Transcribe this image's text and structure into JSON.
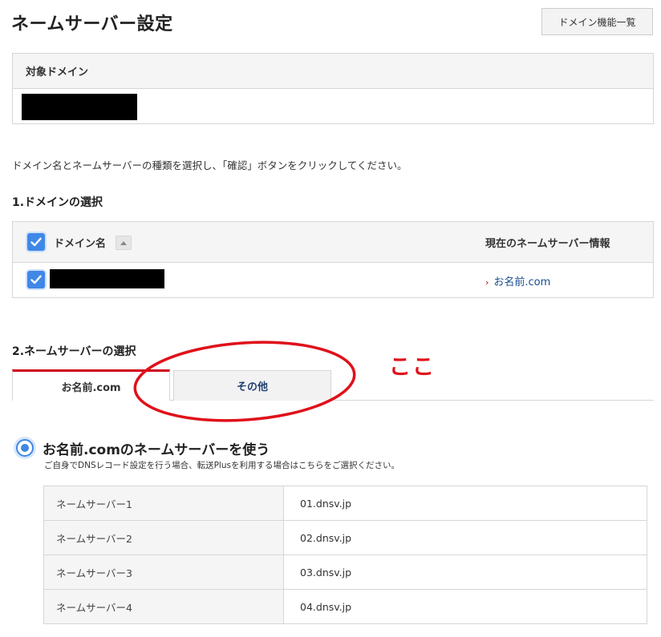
{
  "header": {
    "title": "ネームサーバー設定",
    "domain_list_button": "ドメイン機能一覧"
  },
  "target_domain": {
    "heading": "対象ドメイン"
  },
  "instruction": "ドメイン名とネームサーバーの種類を選択し、「確認」ボタンをクリックしてください。",
  "section1": {
    "title": "1.ドメインの選択",
    "columns": {
      "domain": "ドメイン名",
      "current_ns": "現在のネームサーバー情報"
    },
    "rows": [
      {
        "checked": true,
        "current_ns": "お名前.com"
      }
    ]
  },
  "section2": {
    "title": "2.ネームサーバーの選択",
    "tabs": [
      {
        "label": "お名前.com",
        "active": true
      },
      {
        "label": "その他",
        "active": false
      }
    ],
    "option": {
      "label": "お名前.comのネームサーバーを使う",
      "note": "ご自身でDNSレコード設定を行う場合、転送Plusを利用する場合はこちらをご選択ください。",
      "selected": true
    },
    "nameservers": [
      {
        "label": "ネームサーバー1",
        "value": "01.dnsv.jp"
      },
      {
        "label": "ネームサーバー2",
        "value": "02.dnsv.jp"
      },
      {
        "label": "ネームサーバー3",
        "value": "03.dnsv.jp"
      },
      {
        "label": "ネームサーバー4",
        "value": "04.dnsv.jp"
      }
    ]
  },
  "annotation": {
    "text": "ここ",
    "color": "#e0101a"
  },
  "colors": {
    "accent_blue": "#3f88e6",
    "tab_active_red": "#d0021b",
    "link": "#1a4d8f"
  }
}
